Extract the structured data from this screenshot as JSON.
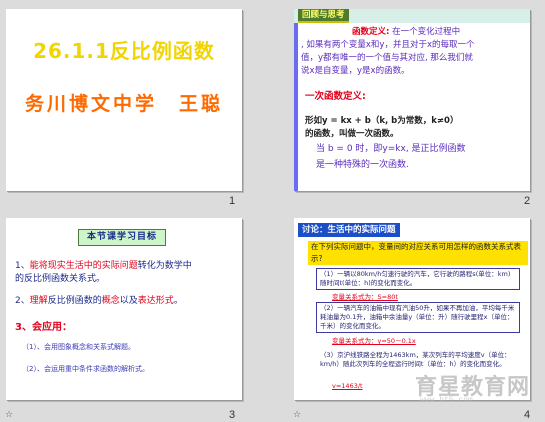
{
  "slide1": {
    "title": "26.1.1反比例函数",
    "subtitle": "务川博文中学　王聪",
    "number": "1"
  },
  "slide2": {
    "header": "回顾与思考",
    "def_label": "函数定义:",
    "def_text1": "在一个变化过程中",
    "def_text2": ", 如果有两个变量x和y，并且对于x的每取一个",
    "def_text3": "值，y都有唯一的一个值与其对应, 那么我们就",
    "def_text4": "说x是自变量，y是x的函数。",
    "linear_label": "一次函数定义:",
    "linear_text1": "形如y = kx + b（k, b为常数，k≠0）",
    "linear_text2": "的函数，叫做一次函数。",
    "special1": "当 b = 0 时，即y=kx, 是正比例函数",
    "special2": "是一种特殊的一次函数.",
    "number": "2"
  },
  "slide3": {
    "header": "本节课学习目标",
    "item1_prefix": "1、",
    "item1_a": "能将现实生活中的实际问题",
    "item1_b": "转化为数学中",
    "item1_c": "的反比例函数关系式。",
    "item2_prefix": "2、",
    "item2_a": "理解",
    "item2_b": "反比例函数的",
    "item2_c": "概念",
    "item2_d": "以及",
    "item2_e": "表达形式",
    "item2_f": "。",
    "item3": "3、会应用：",
    "sub1": "（1）、会用图象概念和关系式解题。",
    "sub2": "（2）、会运用重中条件求函数的解析式。",
    "number": "3"
  },
  "slide4": {
    "header": "讨论：生活中的实际问题",
    "question": "在下列实际问题中，变量间的对应关系可用怎样的函数关系式表示?",
    "p1": "（1）一辆以80km/h匀速行驶的汽车，它行驶的路程s(单位：km)随时间t(单位：h)的变化而变化。",
    "p1_rel": "变量关系式为：S=80t",
    "p2": "（2）一辆汽车的油箱中现有汽油50升，如果不再加油，平均每千米耗油量为0.1升，油箱中余油量y（单位：升）随行驶里程x（单位：千米）的变化而变化。",
    "p2_rel": "变量关系式为：y=50－0.1x",
    "p3": "（3）京沪线铁路全程为1463km，某次列车的平均速度v（单位：km/h）随此次列车的全程运行时间t（单位：h）的变化而变化。",
    "p3_rel": "v=1463/t",
    "number": "4"
  },
  "watermark": {
    "text": "育星教育网",
    "url": "www.ht5.com"
  }
}
